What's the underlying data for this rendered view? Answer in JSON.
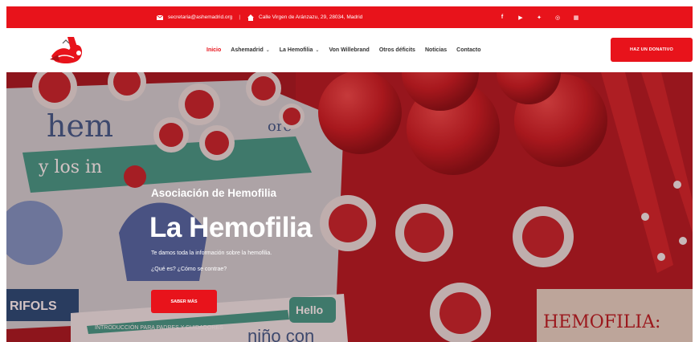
{
  "colors": {
    "brand": "#e8131b",
    "hero_tint": "#6a1e25"
  },
  "topbar": {
    "email_icon": "envelope-icon",
    "email": "secretaria@ashemadrid.org",
    "separator": "|",
    "address_icon": "home-icon",
    "address": "Calle Virgen de Aránzazu, 29, 28034, Madrid",
    "socials": [
      {
        "icon": "facebook-icon",
        "glyph": "f"
      },
      {
        "icon": "youtube-icon",
        "glyph": "▶"
      },
      {
        "icon": "twitter-icon",
        "glyph": "✦"
      },
      {
        "icon": "instagram-icon",
        "glyph": "◎"
      },
      {
        "icon": "linkedin-icon",
        "glyph": "▦"
      }
    ]
  },
  "header": {
    "logo_icon": "ashemadrid-logo",
    "nav": [
      {
        "label": "Inicio",
        "active": true,
        "dropdown": false
      },
      {
        "label": "Ashemadrid",
        "active": false,
        "dropdown": true
      },
      {
        "label": "La Hemofilia",
        "active": false,
        "dropdown": true
      },
      {
        "label": "Von Willebrand",
        "active": false,
        "dropdown": false
      },
      {
        "label": "Otros déficits",
        "active": false,
        "dropdown": false
      },
      {
        "label": "Noticias",
        "active": false,
        "dropdown": false
      },
      {
        "label": "Contacto",
        "active": false,
        "dropdown": false
      }
    ],
    "donate_label": "HAZ UN DONATIVO"
  },
  "hero": {
    "subtitle": "Asociación de Hemofilia",
    "title": "La Hemofilia",
    "text1": "Te damos toda la información sobre la hemofilia.",
    "text2": "¿Qué es? ¿Cómo se contrae?",
    "button_label": "SABER MÁS",
    "image_text": {
      "brochure_top": "hem",
      "brochure_bottom": "y los in",
      "brochure_right": "ore",
      "sign_left": "RIFOLS",
      "book_title": "HEMOFILIA:",
      "booklet_hello": "Hello",
      "booklet_strip": "INTRODUCCIÓN PARA PADRES Y CUIDADORES",
      "booklet_bottom": "niño con"
    }
  }
}
